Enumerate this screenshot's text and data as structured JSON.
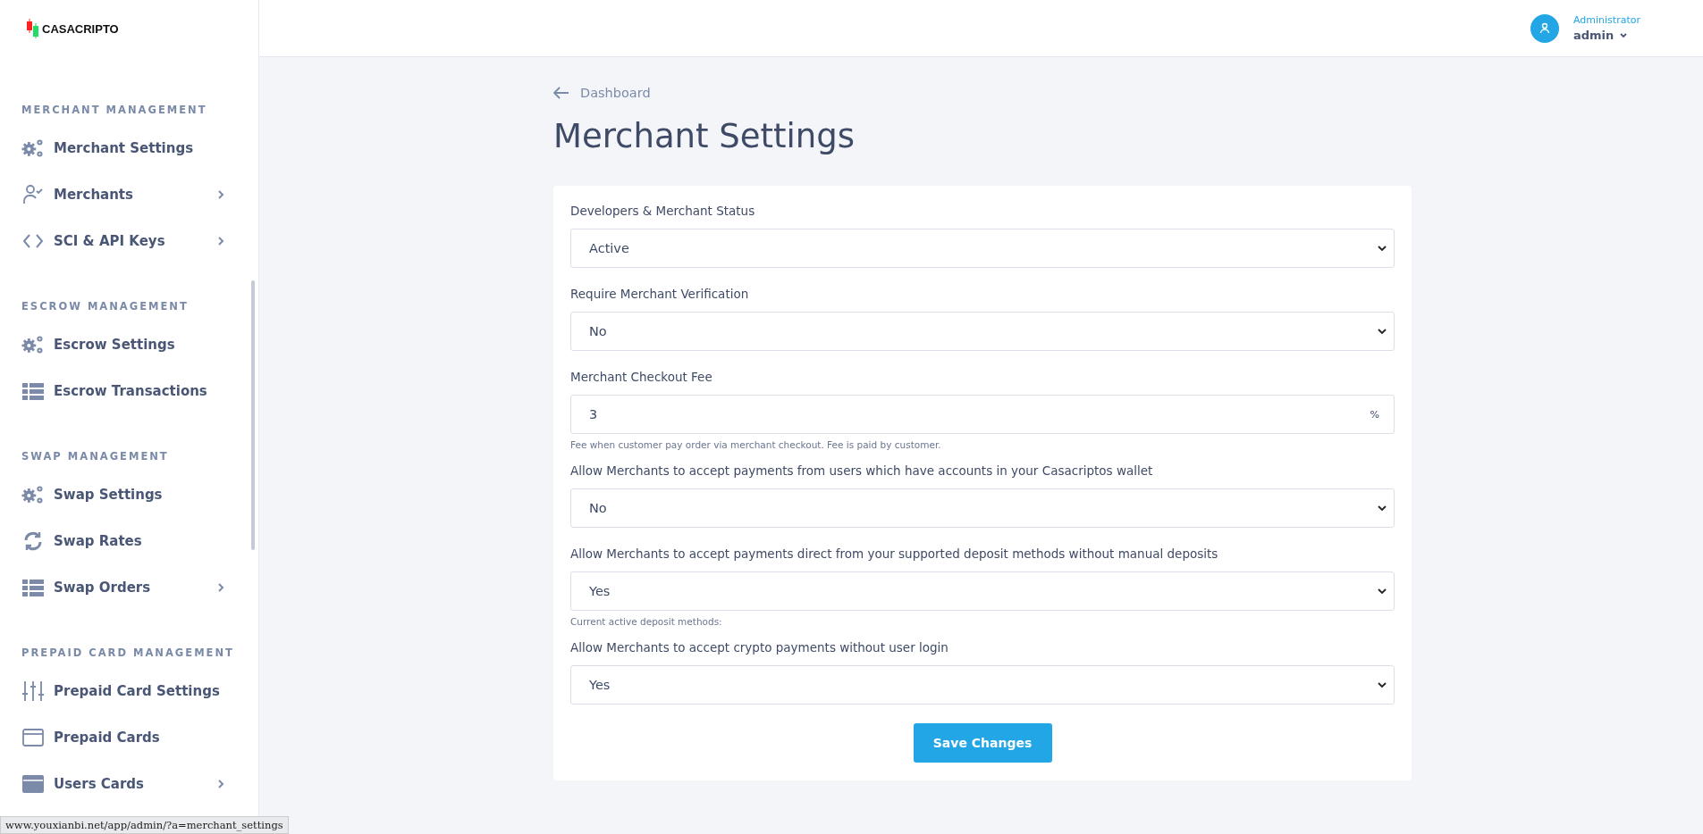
{
  "logo": {
    "text": "CASACRIPTO"
  },
  "sidebar": {
    "sections": [
      {
        "title": "MERCHANT MANAGEMENT",
        "items": [
          {
            "label": "Merchant Settings",
            "has_submenu": false
          },
          {
            "label": "Merchants",
            "has_submenu": true
          },
          {
            "label": "SCI & API Keys",
            "has_submenu": true
          }
        ]
      },
      {
        "title": "ESCROW MANAGEMENT",
        "items": [
          {
            "label": "Escrow Settings",
            "has_submenu": false
          },
          {
            "label": "Escrow Transactions",
            "has_submenu": false
          }
        ]
      },
      {
        "title": "SWAP MANAGEMENT",
        "items": [
          {
            "label": "Swap Settings",
            "has_submenu": false
          },
          {
            "label": "Swap Rates",
            "has_submenu": false
          },
          {
            "label": "Swap Orders",
            "has_submenu": true
          }
        ]
      },
      {
        "title": "PREPAID CARD MANAGEMENT",
        "items": [
          {
            "label": "Prepaid Card Settings",
            "has_submenu": false
          },
          {
            "label": "Prepaid Cards",
            "has_submenu": false
          },
          {
            "label": "Users Cards",
            "has_submenu": true
          }
        ]
      }
    ]
  },
  "user": {
    "role": "Administrator",
    "name": "admin"
  },
  "breadcrumb": "Dashboard",
  "title": "Merchant Settings",
  "form": {
    "fields": [
      {
        "kind": "select",
        "label": "Developers & Merchant Status",
        "value": "Active"
      },
      {
        "kind": "select",
        "label": "Require Merchant Verification",
        "value": "No"
      },
      {
        "kind": "text",
        "label": "Merchant Checkout Fee",
        "value": "3",
        "suffix": "%",
        "help": "Fee when customer pay order via merchant checkout. Fee is paid by customer."
      },
      {
        "kind": "select",
        "label": "Allow Merchants to accept payments from users which have accounts in your Casacriptos wallet",
        "value": "No"
      },
      {
        "kind": "select",
        "label": "Allow Merchants to accept payments direct from your supported deposit methods without manual deposits",
        "value": "Yes",
        "help": "Current active deposit methods:"
      },
      {
        "kind": "select",
        "label": "Allow Merchants to accept crypto payments without user login",
        "value": "Yes"
      }
    ],
    "submit": "Save Changes"
  },
  "status_url": "www.youxianbi.net/app/admin/?a=merchant_settings"
}
